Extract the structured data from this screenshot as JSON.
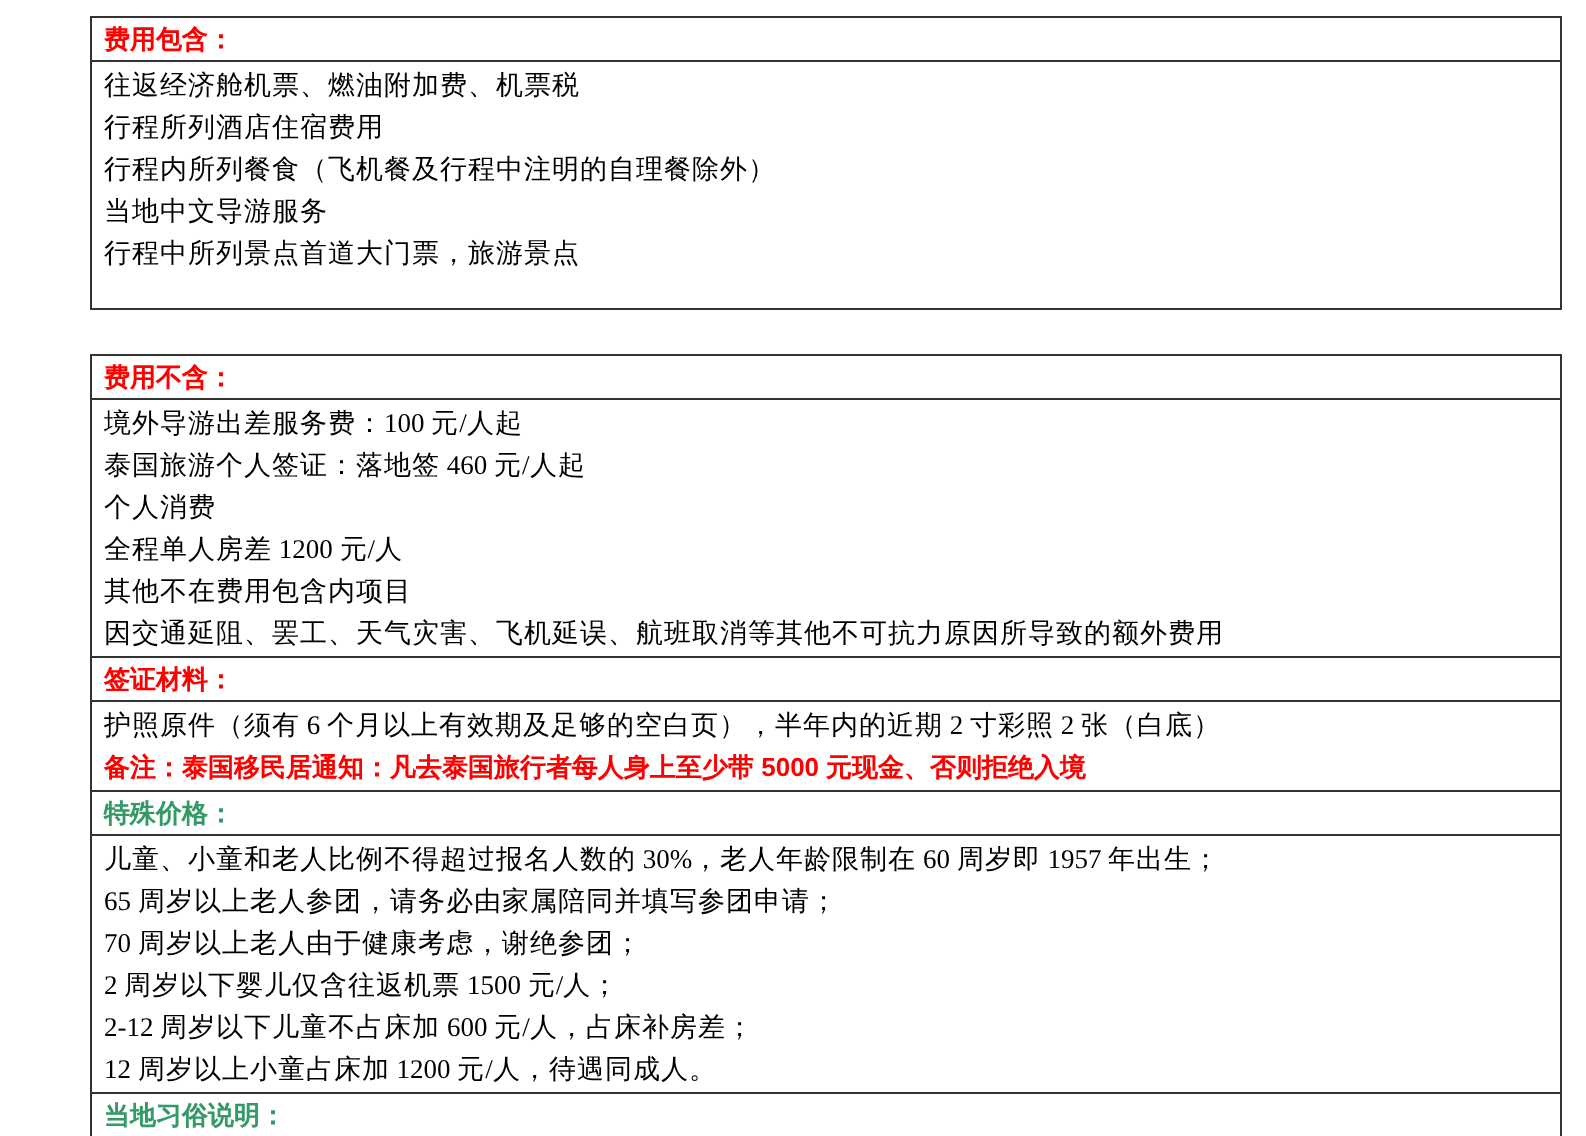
{
  "tables": [
    {
      "sections": [
        {
          "heading": "费用包含：",
          "color": "#ff0000",
          "lines": [
            {
              "kind": "plain",
              "text": "往返经济舱机票、燃油附加费、机票税"
            },
            {
              "kind": "plain",
              "text": "行程所列酒店住宿费用"
            },
            {
              "kind": "plain",
              "text": "行程内所列餐食（飞机餐及行程中注明的自理餐除外）"
            },
            {
              "kind": "plain",
              "text": "当地中文导游服务"
            },
            {
              "kind": "plain",
              "text": "行程中所列景点首道大门票，旅游景点"
            }
          ]
        }
      ]
    },
    {
      "sections": [
        {
          "heading": "费用不含：",
          "color": "#ff0000",
          "lines": [
            {
              "kind": "plain",
              "text": "境外导游出差服务费：100 元/人起"
            },
            {
              "kind": "plain",
              "text": "泰国旅游个人签证：落地签 460 元/人起"
            },
            {
              "kind": "plain",
              "text": "个人消费"
            },
            {
              "kind": "plain",
              "text": "全程单人房差 1200 元/人"
            },
            {
              "kind": "plain",
              "text": "其他不在费用包含内项目"
            },
            {
              "kind": "plain",
              "text": "因交通延阻、罢工、天气灾害、飞机延误、航班取消等其他不可抗力原因所导致的额外费用"
            }
          ]
        },
        {
          "heading": "签证材料：",
          "color": "#ff0000",
          "lines": [
            {
              "kind": "plain",
              "text": "护照原件（须有 6 个月以上有效期及足够的空白页），半年内的近期 2 寸彩照 2 张（白底）"
            },
            {
              "kind": "warning",
              "text": "备注：泰国移民居通知：凡去泰国旅行者每人身上至少带 5000 元现金、否则拒绝入境"
            }
          ]
        },
        {
          "heading": "特殊价格：",
          "color": "#339966",
          "lines": [
            {
              "kind": "plain",
              "text": "儿童、小童和老人比例不得超过报名人数的 30%，老人年龄限制在 60 周岁即 1957 年出生；"
            },
            {
              "kind": "plain",
              "text": "65 周岁以上老人参团，请务必由家属陪同并填写参团申请；"
            },
            {
              "kind": "plain",
              "text": "70 周岁以上老人由于健康考虑，谢绝参团；"
            },
            {
              "kind": "plain",
              "text": "2 周岁以下婴儿仅含往返机票 1500 元/人；"
            },
            {
              "kind": "plain",
              "text": "2-12 周岁以下儿童不占床加 600 元/人，占床补房差；"
            },
            {
              "kind": "plain",
              "text": "12 周岁以上小童占床加 1200 元/人，待遇同成人。"
            }
          ]
        },
        {
          "heading": "当地习俗说明：",
          "color": "#339966"
        }
      ]
    }
  ]
}
